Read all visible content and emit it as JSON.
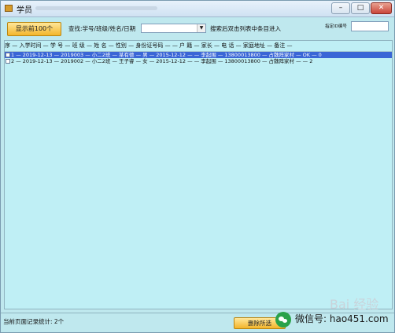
{
  "window": {
    "title": "学员",
    "icons": {
      "app": "app-icon",
      "min": "minimize-icon",
      "max": "maximize-icon",
      "close": "close-icon"
    },
    "controls": {
      "min": "–",
      "max": "□",
      "close": "✕"
    }
  },
  "toolbar": {
    "show_top_label": "显示前100个",
    "search_label": "查找:学号/班级/姓名/日期",
    "search_value": "",
    "combo_arrow": "▼",
    "search_hint": "搜索后双击列表中条目进入",
    "id_label": "指定ID编号",
    "id_value": ""
  },
  "table": {
    "header_text": "序 — 入学时间 — 学 号 — 班 级 — 姓 名 — 性别 — 身份证号码 — — 户 籍 — 家长 — 电 话 — 家庭地址 — 备注 —",
    "rows": [
      {
        "text": "1 — 2019-12-13 — 2019003 — 小二2班 — 某有德 — 男 — 2015-12-12 — — 李起围 — 13800013800 — 占魏阵家村 — OK — 0",
        "selected": true
      },
      {
        "text": "2 — 2019-12-13 — 2019002 — 小二2班 — 王子睿 — 女 — 2015-12-12 — — 李起围 — 13800013800 — 占魏阵家村 — — 2",
        "selected": false
      }
    ]
  },
  "status": {
    "record_count_text": "当前页面记录统计: 2个",
    "delete_label": "删除所选"
  },
  "watermark": {
    "logo_text": "Bai 经验",
    "text": "微信号: hao451.com"
  },
  "colors": {
    "background": "#bfe8ee",
    "button_yellow": "#f3b52a",
    "selection": "#3a66d6"
  }
}
